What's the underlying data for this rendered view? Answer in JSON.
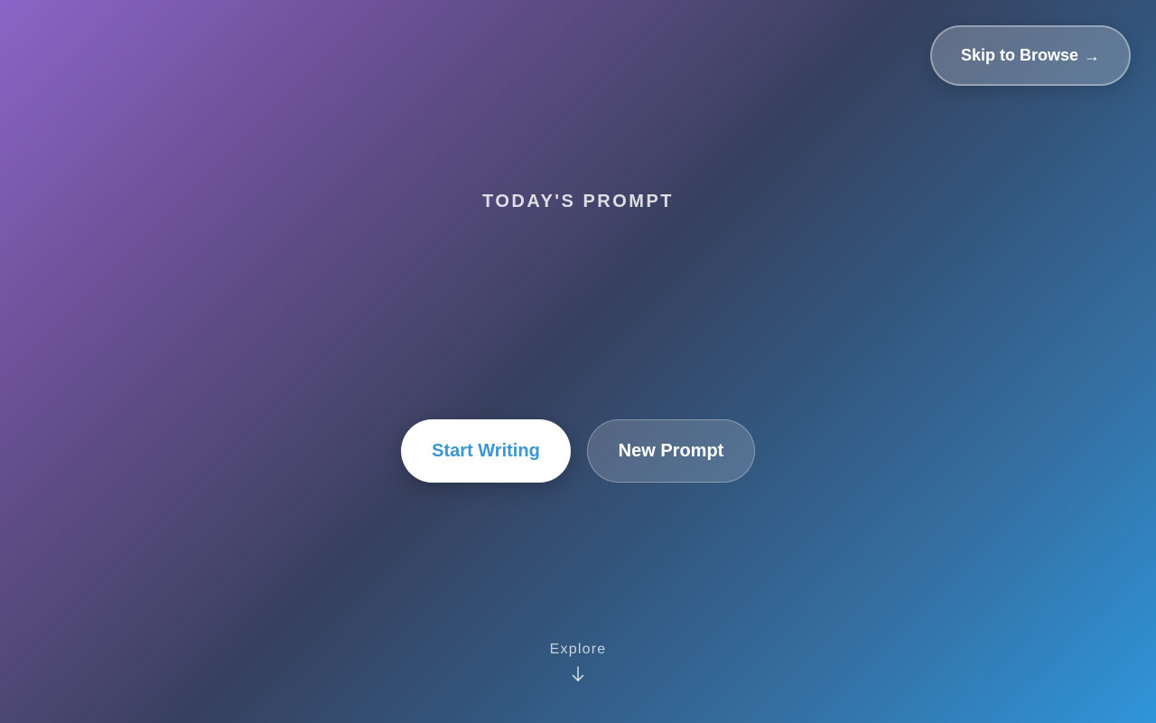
{
  "header": {
    "skip_label": "Skip to Browse",
    "skip_icon": "arrow-right-icon"
  },
  "hero": {
    "label": "TODAY'S PROMPT",
    "prompt_text": ""
  },
  "actions": {
    "start_label": "Start Writing",
    "new_prompt_label": "New Prompt"
  },
  "explore": {
    "label": "Explore",
    "icon": "arrow-down-icon"
  },
  "colors": {
    "gradient_start": "#8b65c7",
    "gradient_mid": "#37405e",
    "gradient_end": "#2f95da",
    "primary_button_text": "#3a97cf"
  }
}
